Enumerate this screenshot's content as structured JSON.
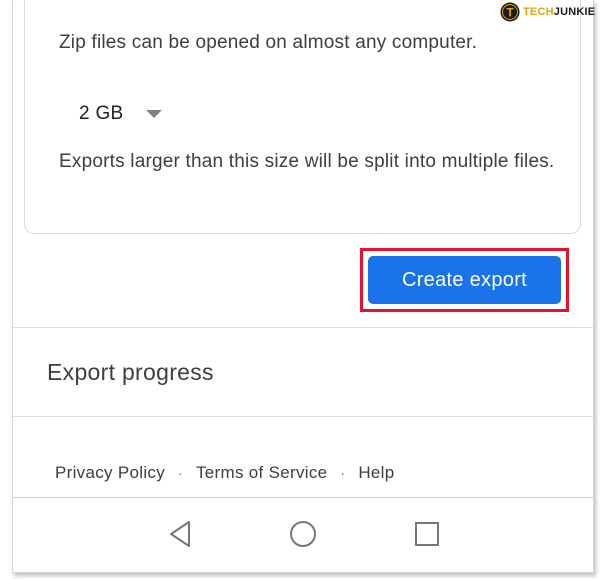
{
  "export_settings": {
    "zip_note": "Zip files can be opened on almost any computer.",
    "size_select": {
      "value": "2 GB"
    },
    "split_note": "Exports larger than this size will be split into multiple files."
  },
  "actions": {
    "create_export_label": "Create export"
  },
  "progress": {
    "title": "Export progress"
  },
  "footer": {
    "links": [
      "Privacy Policy",
      "Terms of Service",
      "Help"
    ],
    "separator": "·"
  },
  "navbar": {
    "icons": [
      "back-icon",
      "home-icon",
      "recents-icon"
    ]
  },
  "watermark": {
    "badge": "T",
    "brand_prefix": "TECH",
    "brand_suffix": "JUNKIE"
  },
  "colors": {
    "primary_button": "#1a73e8",
    "highlight": "#e8102a",
    "text": "#3c4043",
    "divider": "#dadce0"
  }
}
